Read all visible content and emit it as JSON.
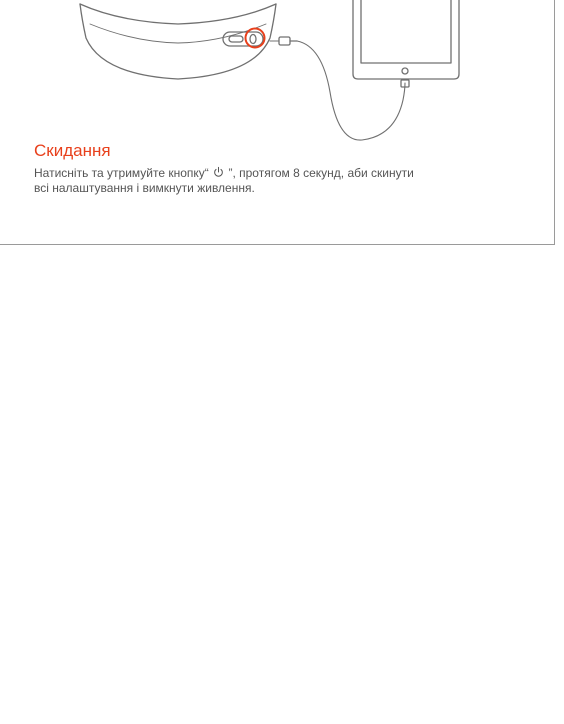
{
  "colors": {
    "accent": "#e8401c",
    "body_text": "#555555",
    "line_art": "#707070",
    "frame": "#9a9a9a"
  },
  "reset_section": {
    "title": "Скидання",
    "body_before_icon": "Натисніть та утримуйте кнопку“",
    "power_icon": "power-icon",
    "body_after_icon": "”, протягом 8 секунд, аби скинути",
    "body_line2": "всі налаштування і вимкнути живлення."
  }
}
